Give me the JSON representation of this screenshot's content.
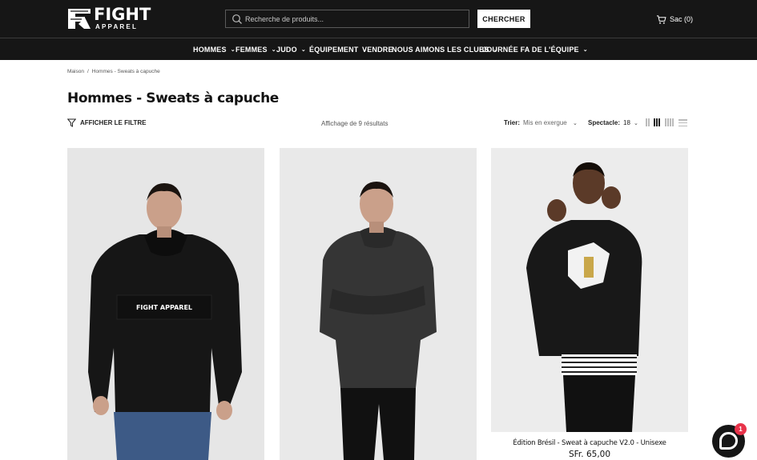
{
  "header": {
    "logo_text": "FIGHT",
    "logo_subtext": "APPAREL",
    "search": {
      "placeholder": "Recherche de produits...",
      "value": "",
      "icon": "search-icon"
    },
    "search_button": "CHERCHER",
    "cart_label": "Sac (0)",
    "cart_icon": "cart-icon"
  },
  "nav": {
    "items": [
      {
        "label": "HOMMES",
        "dropdown": true
      },
      {
        "label": "FEMMES",
        "dropdown": true
      },
      {
        "label": "JUDO",
        "dropdown": true
      },
      {
        "label": "ÉQUIPEMENT",
        "dropdown": true
      },
      {
        "label": "VENDRE",
        "dropdown": false
      },
      {
        "label": "NOUS AIMONS LES CLUBS",
        "dropdown": true
      },
      {
        "label": "JOURNÉE FA DE L'ÉQUIPE",
        "dropdown": true
      }
    ]
  },
  "breadcrumb": {
    "home": "Maison",
    "separator": "/",
    "current": "Hommes - Sweats à capuche"
  },
  "page_title": "Hommes - Sweats à capuche",
  "toolbar": {
    "filter_label": "AFFICHER LE FILTRE",
    "filter_icon": "filter-icon",
    "results": "Affichage de 9 résultats",
    "sort_label": "Trier:",
    "sort_value": "Mis en exergue",
    "show_label": "Spectacle:",
    "show_value": "18",
    "views": [
      "grid-2",
      "grid-3",
      "grid-4",
      "list"
    ],
    "active_view": "grid-3"
  },
  "products": [
    {
      "name": "",
      "price": "",
      "color": "black"
    },
    {
      "name": "",
      "price": "",
      "color": "dark-grey"
    },
    {
      "name": "Édition Brésil - Sweat à capuche V2.0 - Unisexe",
      "price": "SFr. 65,00",
      "color": "black"
    }
  ],
  "print_text": "FIGHT APPAREL",
  "chat": {
    "badge": "1",
    "icon": "chat-icon"
  },
  "colors": {
    "header_bg": "#161616",
    "page_bg": "#ffffff",
    "badge": "#e8334a",
    "image_bg": "#e9e9e9"
  }
}
